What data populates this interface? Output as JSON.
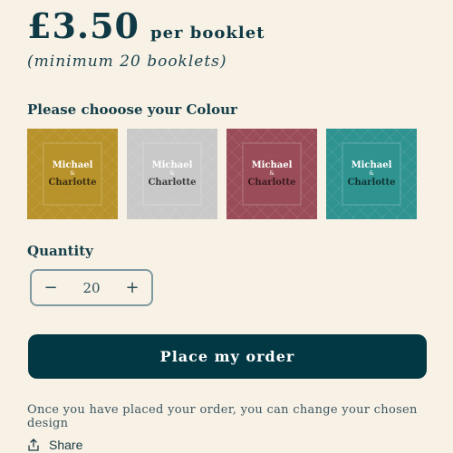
{
  "price": {
    "amount": "£3.50",
    "unit": "per booklet",
    "minimum": "(minimum 20 booklets)"
  },
  "colour": {
    "label": "Please chooose your Colour",
    "options": [
      {
        "bg": "#b8922a",
        "name1": "Michael",
        "amp": "&",
        "name2": "Charlotte",
        "color1": "#ffffff",
        "color2": "#3b2f12"
      },
      {
        "bg": "#c9c9c9",
        "name1": "Michael",
        "amp": "&",
        "name2": "Charlotte",
        "color1": "#ffffff",
        "color2": "#3a3a3a"
      },
      {
        "bg": "#9a4d58",
        "name1": "Michael",
        "amp": "&",
        "name2": "Charlotte",
        "color1": "#ffffff",
        "color2": "#3b1a20"
      },
      {
        "bg": "#2f9390",
        "name1": "Michael",
        "amp": "&",
        "name2": "Charlotte",
        "color1": "#ffffff",
        "color2": "#0f3432"
      }
    ]
  },
  "quantity": {
    "label": "Quantity",
    "value": "20",
    "decrement": "−",
    "increment": "+"
  },
  "order_button": "Place my order",
  "note": "Once you have placed your order, you can change your chosen design",
  "share": {
    "label": "Share",
    "icon": "share-icon"
  }
}
